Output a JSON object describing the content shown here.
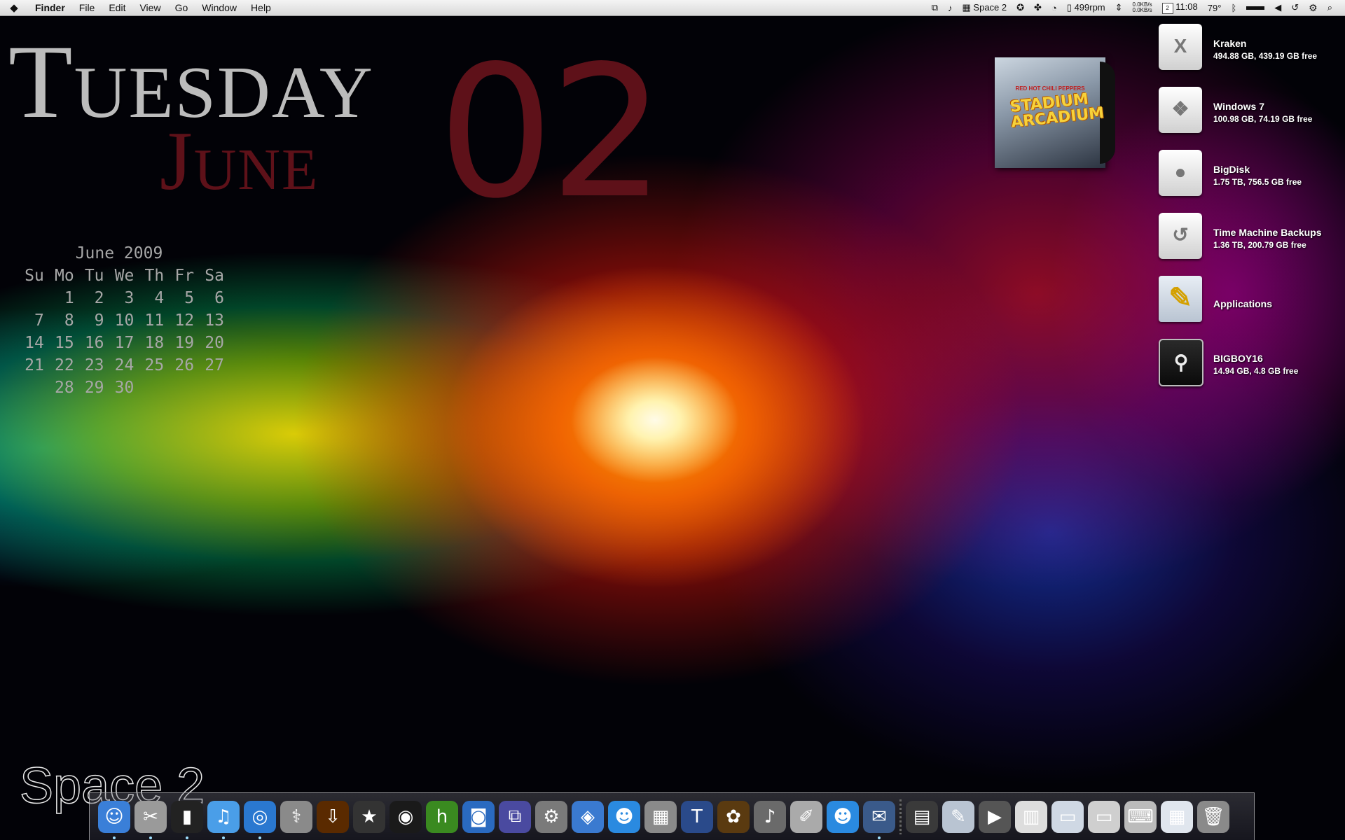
{
  "menubar": {
    "apple_icon": "apple-logo-icon",
    "items": [
      "Finder",
      "File",
      "Edit",
      "View",
      "Go",
      "Window",
      "Help"
    ],
    "space": "Space 2",
    "fan_speed": "499rpm",
    "net_up": "0.0KB/s",
    "net_down": "0.0KB/s",
    "cal_day": "2",
    "time": "11:08",
    "temperature": "79°"
  },
  "date_display": {
    "day_name": "Tuesday",
    "month_name": "June",
    "day_number": "02"
  },
  "calendar": {
    "title": "June 2009",
    "weekdays": [
      "Su",
      "Mo",
      "Tu",
      "We",
      "Th",
      "Fr",
      "Sa"
    ],
    "weeks": [
      [
        "",
        "1",
        "2",
        "3",
        "4",
        "5",
        "6"
      ],
      [
        "7",
        "8",
        "9",
        "10",
        "11",
        "12",
        "13"
      ],
      [
        "14",
        "15",
        "16",
        "17",
        "18",
        "19",
        "20"
      ],
      [
        "21",
        "22",
        "23",
        "24",
        "25",
        "26",
        "27"
      ],
      [
        "",
        "28",
        "29",
        "30",
        "",
        "",
        ""
      ]
    ]
  },
  "album": {
    "artist": "RED HOT CHILI PEPPERS",
    "title": "STADIUM ARCADIUM"
  },
  "drives": [
    {
      "name": "Kraken",
      "info": "494.88 GB, 439.19 GB free",
      "icon": "x-drive-icon",
      "glyph": "X"
    },
    {
      "name": "Windows 7",
      "info": "100.98 GB, 74.19 GB free",
      "icon": "windows-drive-icon",
      "glyph": "❖"
    },
    {
      "name": "BigDisk",
      "info": "1.75 TB, 756.5 GB free",
      "icon": "apple-drive-icon",
      "glyph": "●"
    },
    {
      "name": "Time Machine Backups",
      "info": "1.36 TB, 200.79 GB free",
      "icon": "time-machine-drive-icon",
      "glyph": "↺"
    },
    {
      "name": "Applications",
      "info": "",
      "icon": "applications-folder-icon",
      "glyph": "✎"
    },
    {
      "name": "BIGBOY16",
      "info": "14.94 GB, 4.8 GB free",
      "icon": "usb-drive-icon",
      "glyph": "⚲"
    }
  ],
  "space_label": "Space 2",
  "dock": {
    "apps": [
      {
        "icon": "finder-icon",
        "bg": "#3a7fd8",
        "glyph": "☺",
        "running": true
      },
      {
        "icon": "preview-icon",
        "bg": "#9a9a9a",
        "glyph": "✂",
        "running": true
      },
      {
        "icon": "terminal-icon",
        "bg": "#222222",
        "glyph": "▮",
        "running": true
      },
      {
        "icon": "itunes-icon",
        "bg": "#4a9ee8",
        "glyph": "♫",
        "running": true
      },
      {
        "icon": "safari-icon",
        "bg": "#2a78d0",
        "glyph": "◎",
        "running": true
      },
      {
        "icon": "disk-utility-icon",
        "bg": "#8a8a8a",
        "glyph": "⚕",
        "running": false
      },
      {
        "icon": "download-icon",
        "bg": "#5a2a00",
        "glyph": "⇩",
        "running": false
      },
      {
        "icon": "imovie-icon",
        "bg": "#333333",
        "glyph": "★",
        "running": false
      },
      {
        "icon": "aperture-icon",
        "bg": "#1a1a1a",
        "glyph": "◉",
        "running": false
      },
      {
        "icon": "hulu-icon",
        "bg": "#3a8a20",
        "glyph": "h",
        "running": false
      },
      {
        "icon": "camera-icon",
        "bg": "#2a6ac0",
        "glyph": "◙",
        "running": false
      },
      {
        "icon": "vmware-icon",
        "bg": "#4a4aa0",
        "glyph": "⧉",
        "running": false
      },
      {
        "icon": "system-preferences-icon",
        "bg": "#7a7a7a",
        "glyph": "⚙",
        "running": false
      },
      {
        "icon": "eye-tv-icon",
        "bg": "#3a7ad0",
        "glyph": "◈",
        "running": false
      },
      {
        "icon": "messenger-icon",
        "bg": "#2a8ae0",
        "glyph": "☻",
        "running": false
      },
      {
        "icon": "calculator-icon",
        "bg": "#8a8a8a",
        "glyph": "▦",
        "running": false
      },
      {
        "icon": "textedit-icon",
        "bg": "#2a4a8a",
        "glyph": "T",
        "running": false
      },
      {
        "icon": "adium-icon",
        "bg": "#5a3a10",
        "glyph": "✿",
        "running": false
      },
      {
        "icon": "microphone-icon",
        "bg": "#6a6a6a",
        "glyph": "♪",
        "running": false
      },
      {
        "icon": "script-editor-icon",
        "bg": "#aaaaaa",
        "glyph": "✐",
        "running": false
      },
      {
        "icon": "contacts-icon",
        "bg": "#2a8ae0",
        "glyph": "☻",
        "running": false
      },
      {
        "icon": "mail-icon",
        "bg": "#3a5a8a",
        "glyph": "✉",
        "running": true
      }
    ],
    "docs": [
      {
        "icon": "camera-raw-icon",
        "bg": "#3a3a3a",
        "glyph": "▤"
      },
      {
        "icon": "applications-stack-icon",
        "bg": "#b9c4d2",
        "glyph": "✎"
      },
      {
        "icon": "video-camera-icon",
        "bg": "#555555",
        "glyph": "▶"
      },
      {
        "icon": "document-stack-icon",
        "bg": "#dddddd",
        "glyph": "▥"
      },
      {
        "icon": "window-stack-icon",
        "bg": "#cfd8e4",
        "glyph": "▭"
      },
      {
        "icon": "screens-stack-icon",
        "bg": "#cfcfcf",
        "glyph": "▭"
      },
      {
        "icon": "keyboard-stack-icon",
        "bg": "#bbbbbb",
        "glyph": "⌨"
      },
      {
        "icon": "spreadsheet-stack-icon",
        "bg": "#e0e6ee",
        "glyph": "▦"
      },
      {
        "icon": "trash-icon",
        "bg": "#8a8a8a",
        "glyph": "🗑"
      }
    ]
  }
}
